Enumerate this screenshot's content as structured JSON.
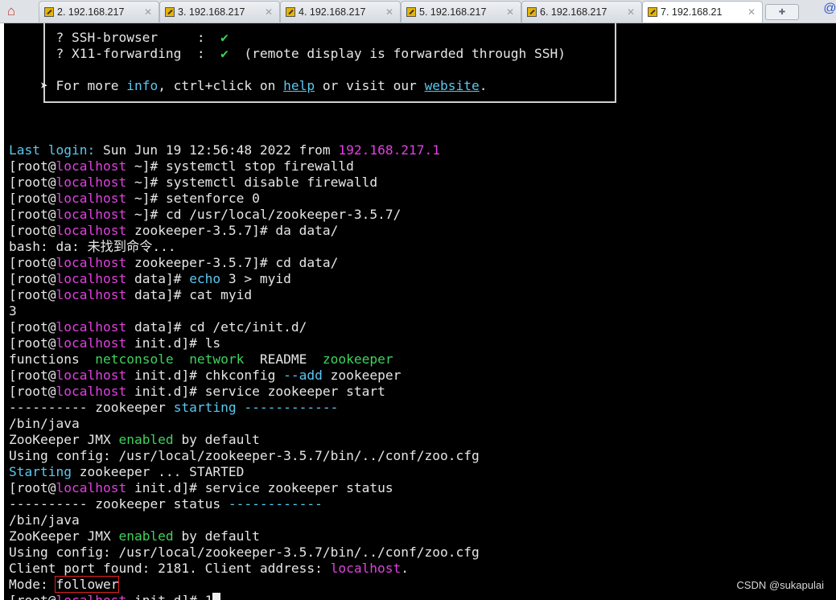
{
  "tabs": [
    {
      "label": "2. 192.168.217"
    },
    {
      "label": "3. 192.168.217"
    },
    {
      "label": "4. 192.168.217"
    },
    {
      "label": "5. 192.168.217"
    },
    {
      "label": "6. 192.168.217"
    },
    {
      "label": "7. 192.168.21"
    }
  ],
  "colors": {
    "terminal_bg": "#000000",
    "prompt_host": "#e040e0",
    "link": "#5ac8f0",
    "green": "#3ed35e",
    "highlight_box": "#e0201b"
  },
  "banner": {
    "l1_name": "? SSH-browser     ",
    "l1_colon": ":",
    "l1_check": "✔",
    "l2_name": "? X11-forwarding  ",
    "l2_colon": ":",
    "l2_check": "✔",
    "l2_note": "(remote display is forwarded through SSH)",
    "l3_arrow": "➤",
    "l3_a": "For more",
    "l3_info": "info",
    "l3_b": ", ctrl+click on",
    "l3_help": "help",
    "l3_c": "or visit our",
    "l3_website": "website",
    "l3_d": "."
  },
  "last_login": {
    "label": "Last login:",
    "text": "Sun Jun 19 12:56:48 2022 from",
    "ip": "192.168.217.1"
  },
  "prompt": {
    "open": "[root@",
    "host": "localhost",
    "close": "]#"
  },
  "lines": {
    "c1_dir": "~",
    "c1_cmd": "systemctl stop firewalld",
    "c2_dir": "~",
    "c2_cmd": "systemctl disable firewalld",
    "c3_dir": "~",
    "c3_cmd": "setenforce 0",
    "c4_dir": "~",
    "c4_cmd": "cd /usr/local/zookeeper-3.5.7/",
    "c5_dir": "zookeeper-3.5.7",
    "c5_cmd": "da data/",
    "err": "bash: da: 未找到命令...",
    "c6_dir": "zookeeper-3.5.7",
    "c6_cmd": "cd data/",
    "c7_dir": "data",
    "c7_echo": "echo",
    "c7_rest": "3 > myid",
    "c8_dir": "data",
    "c8_cmd": "cat myid",
    "out_myid": "3",
    "c9_dir": "data",
    "c9_cmd": "cd /etc/init.d/",
    "c10_dir": "init.d",
    "c10_cmd": "ls",
    "ls_1": "functions",
    "ls_2": "netconsole",
    "ls_3": "network",
    "ls_4": "README",
    "ls_5": "zookeeper",
    "c11_dir": "init.d",
    "c11_a": "chkconfig",
    "c11_flag": "--add",
    "c11_b": "zookeeper",
    "c12_dir": "init.d",
    "c12_cmd": "service zookeeper start",
    "sep1_a": "----------",
    "sep1_b": "zookeeper",
    "sep1_c": "starting",
    "sep1_d": "------------",
    "bin1": "/bin/java",
    "jmx1_a": "ZooKeeper JMX",
    "jmx1_b": "enabled",
    "jmx1_c": "by default",
    "cfg1": "Using config: /usr/local/zookeeper-3.5.7/bin/../conf/zoo.cfg",
    "start_a": "Starting",
    "start_b": "zookeeper ... STARTED",
    "c13_dir": "init.d",
    "c13_cmd": "service zookeeper status",
    "sep2_a": "----------",
    "sep2_b": "zookeeper status",
    "sep2_c": "------------",
    "bin2": "/bin/java",
    "jmx2_a": "ZooKeeper JMX",
    "jmx2_b": "enabled",
    "jmx2_c": "by default",
    "cfg2": "Using config: /usr/local/zookeeper-3.5.7/bin/../conf/zoo.cfg",
    "client_a": "Client port found: 2181. Client address:",
    "client_b": "localhost",
    "client_c": ".",
    "mode_a": "Mode:",
    "mode_b": "follower",
    "c14_dir": "init.d",
    "c14_typed": "1"
  },
  "watermark": "CSDN @sukapulai"
}
